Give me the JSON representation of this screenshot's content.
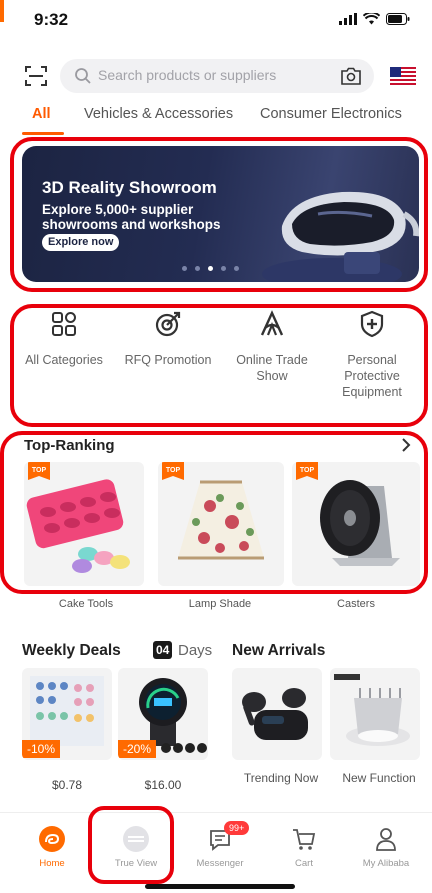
{
  "status_bar": {
    "time": "9:32"
  },
  "search": {
    "placeholder": "Search products or suppliers"
  },
  "tabs": [
    {
      "label": "All",
      "active": true
    },
    {
      "label": "Vehicles & Accessories",
      "active": false
    },
    {
      "label": "Consumer Electronics",
      "active": false
    }
  ],
  "banner": {
    "title": "3D Reality Showroom",
    "subtitle": "Explore 5,000+ supplier showrooms and workshops",
    "cta": "Explore now",
    "dot_count": 5,
    "active_dot": 2
  },
  "quick_links": [
    {
      "label": "All Categories",
      "icon": "grid-icon"
    },
    {
      "label": "RFQ Promotion",
      "icon": "target-icon"
    },
    {
      "label": "Online Trade Show",
      "icon": "trade-show-icon"
    },
    {
      "label": "Personal Protective Equipment",
      "icon": "shield-icon"
    }
  ],
  "ranking": {
    "title": "Top-Ranking",
    "badge": "TOP",
    "items": [
      {
        "label": "Cake Tools"
      },
      {
        "label": "Lamp Shade"
      },
      {
        "label": "Casters"
      }
    ]
  },
  "weekly_deals": {
    "title": "Weekly Deals",
    "days_value": "04",
    "days_label": "Days",
    "items": [
      {
        "discount": "-10%",
        "price": "$0.78"
      },
      {
        "discount": "-20%",
        "price": "$16.00"
      }
    ]
  },
  "new_arrivals": {
    "title": "New Arrivals",
    "items": [
      {
        "label": "Trending Now"
      },
      {
        "label": "New Function"
      }
    ]
  },
  "bottom_nav": [
    {
      "label": "Home",
      "active": true
    },
    {
      "label": "True View",
      "active": false
    },
    {
      "label": "Messenger",
      "badge": "99+",
      "active": false
    },
    {
      "label": "Cart",
      "active": false
    },
    {
      "label": "My Alibaba",
      "active": false
    }
  ],
  "colors": {
    "accent": "#ff6a00",
    "highlight_frame": "#e8000b"
  }
}
